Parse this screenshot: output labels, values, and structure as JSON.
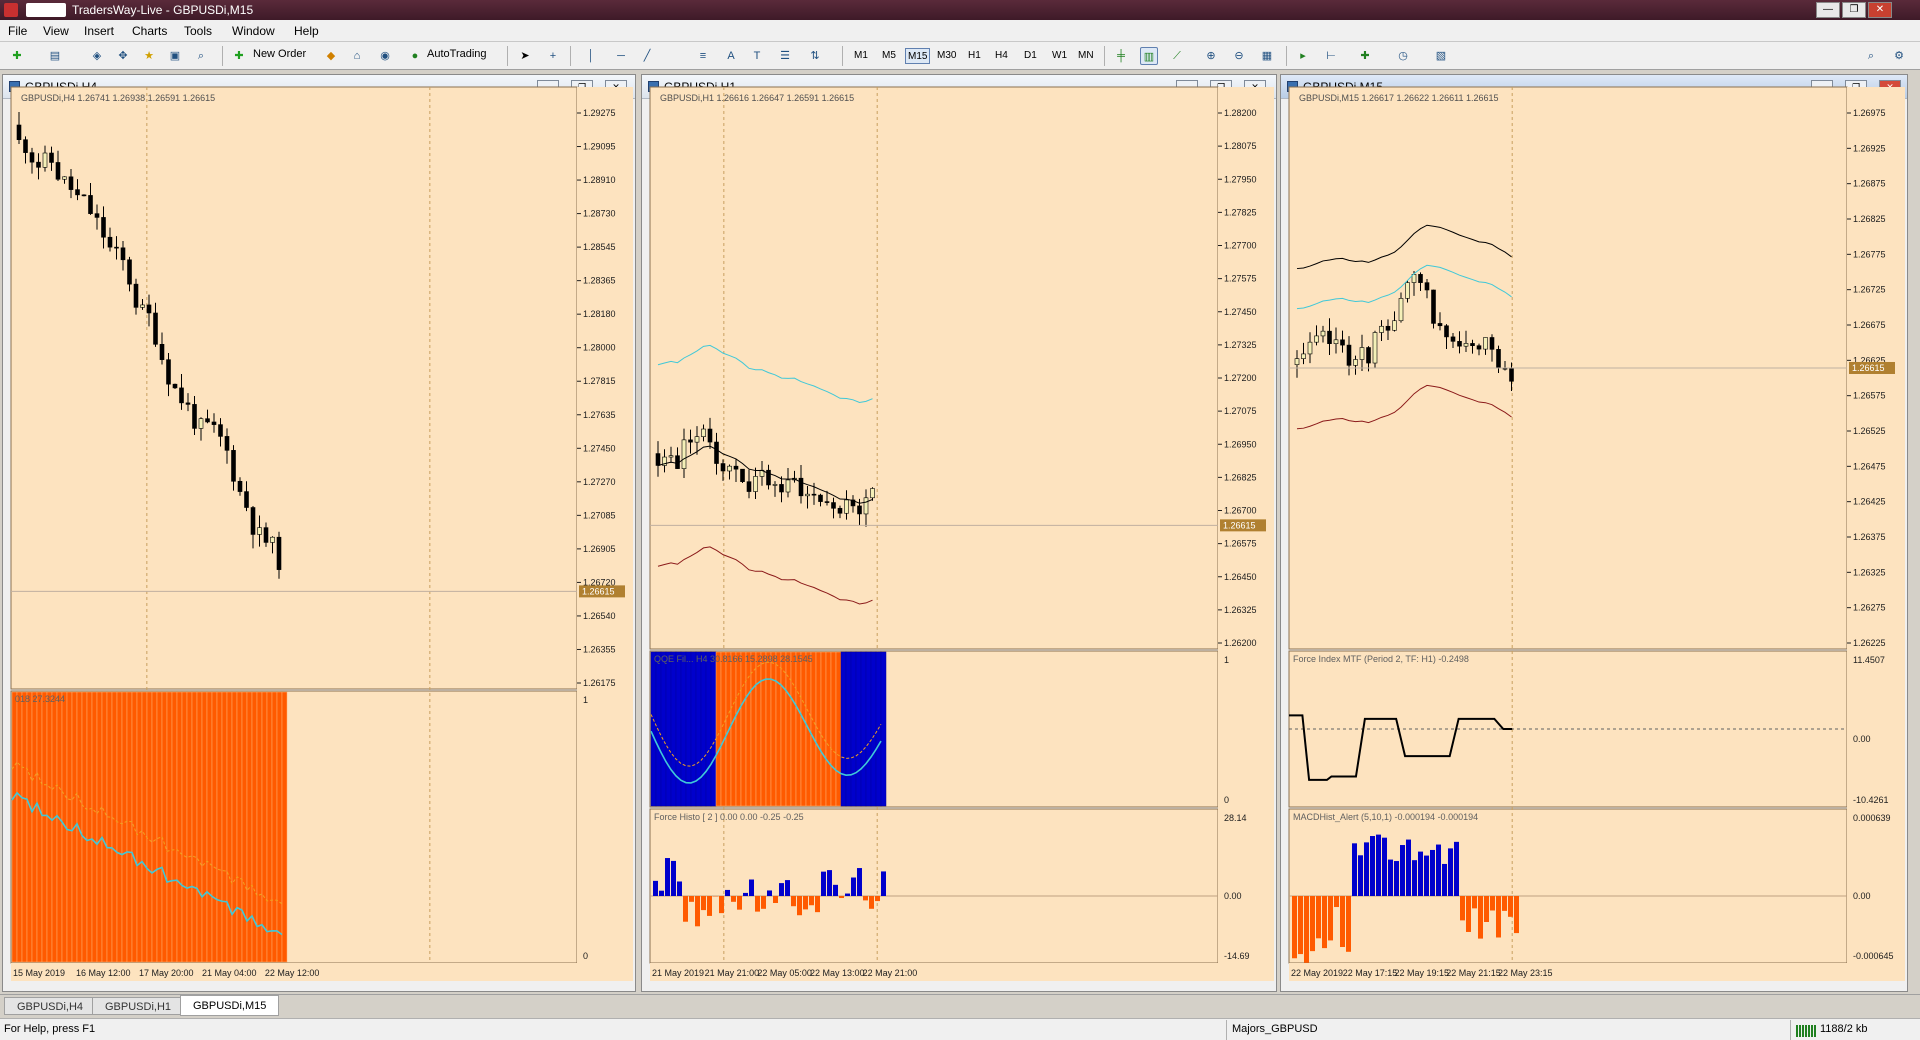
{
  "window": {
    "title": "TradersWay-Live - GBPUSDi,M15",
    "controls": [
      "—",
      "❐",
      "✕"
    ]
  },
  "menu": [
    "File",
    "View",
    "Insert",
    "Charts",
    "Tools",
    "Window",
    "Help"
  ],
  "toolbar": {
    "new_order": "New Order",
    "auto_trading": "AutoTrading",
    "timeframes": [
      "M1",
      "M5",
      "M15",
      "M30",
      "H1",
      "H4",
      "D1",
      "W1",
      "MN"
    ],
    "active_timeframe": "M15"
  },
  "charts": [
    {
      "title": "GBPUSDi,H4",
      "header": "GBPUSDi,H4  1.26741 1.26938 1.26591 1.26615",
      "ylabels": [
        "1.29275",
        "1.29095",
        "1.28910",
        "1.28730",
        "1.28545",
        "1.28365",
        "1.28180",
        "1.28000",
        "1.27815",
        "1.27635",
        "1.27450",
        "1.27270",
        "1.27085",
        "1.26905",
        "1.26720",
        "1.26540",
        "1.26355",
        "1.26175"
      ],
      "ymin": 1.2608,
      "ymax": 1.2936,
      "price": "1.26615",
      "price_value": 1.26615,
      "sub1": {
        "label": "018 27.3244",
        "axis_top": "1",
        "axis_bottom": "0"
      },
      "xlabels": [
        "15 May 2019",
        "16 May 12:00",
        "17 May 20:00",
        "21 May 04:00",
        "22 May 12:00"
      ]
    },
    {
      "title": "GBPUSDi,H1",
      "header": "GBPUSDi,H1  1.26616 1.26647 1.26591 1.26615",
      "ylabels": [
        "1.28200",
        "1.28075",
        "1.27950",
        "1.27825",
        "1.27700",
        "1.27575",
        "1.27450",
        "1.27325",
        "1.27200",
        "1.27075",
        "1.26950",
        "1.26825",
        "1.26700",
        "1.26575",
        "1.26450",
        "1.26325",
        "1.26200"
      ],
      "ymin": 1.2614,
      "ymax": 1.2826,
      "price": "1.26615",
      "price_value": 1.26615,
      "sub1": {
        "label": "QQE Fil... H4   30.8166 15.2898 28.1545",
        "axis_top": "1",
        "axis_bottom": "0"
      },
      "sub2": {
        "label": "Force Histo [ 2 ] 0.00 0.00 -0.25 -0.25",
        "axis_top": "28.14",
        "axis_mid": "0.00",
        "axis_bottom": "-14.69"
      },
      "xlabels": [
        "21 May 2019",
        "21 May 21:00",
        "22 May 05:00",
        "22 May 13:00",
        "22 May 21:00"
      ]
    },
    {
      "title": "GBPUSDi,M15",
      "header": "GBPUSDi,M15  1.26617 1.26622 1.26611 1.26615",
      "ylabels": [
        "1.26975",
        "1.26925",
        "1.26875",
        "1.26825",
        "1.26775",
        "1.26725",
        "1.26675",
        "1.26625",
        "1.26575",
        "1.26525",
        "1.26475",
        "1.26425",
        "1.26375",
        "1.26325",
        "1.26275",
        "1.26225"
      ],
      "ymin": 1.262,
      "ymax": 1.27,
      "price": "1.26615",
      "price_value": 1.26615,
      "sub1": {
        "label": "Force Index MTF (Period 2, TF: H1) -0.2498",
        "axis_top": "11.4507",
        "axis_mid": "0.00",
        "axis_bottom": "-10.4261"
      },
      "sub2": {
        "label": "MACDHist_Alert (5,10,1) -0.000194 -0.000194",
        "axis_top": "0.000639",
        "axis_mid": "0.00",
        "axis_bottom": "-0.000645"
      },
      "xlabels": [
        "22 May 2019",
        "22 May 17:15",
        "22 May 19:15",
        "22 May 21:15",
        "22 May 23:15"
      ]
    }
  ],
  "tabs": [
    "GBPUSDi,H4",
    "GBPUSDi,H1",
    "GBPUSDi,M15"
  ],
  "active_tab": "GBPUSDi,M15",
  "status": {
    "help": "For Help, press F1",
    "profile": "Majors_GBPUSD",
    "traffic": "1188/2 kb"
  },
  "colors": {
    "chart_bg": "#fde3bf",
    "bull_candle": "#f5f0b8",
    "bear_candle": "#000000",
    "orange": "#ff5a00",
    "blue": "#0000cc",
    "cyan": "#40c8d8",
    "darkred": "#8b1a1a",
    "grid": "#c8a060"
  }
}
